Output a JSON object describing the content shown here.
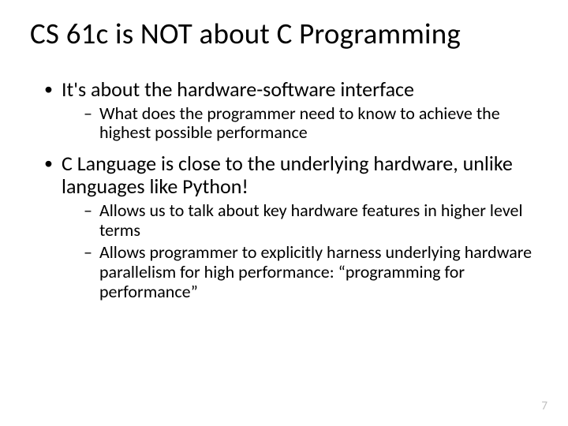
{
  "title": "CS 61c is NOT about C Programming",
  "bullets": [
    {
      "text": "It's about the hardware-software interface",
      "sub": [
        "What does the programmer need to know to achieve the highest possible performance"
      ]
    },
    {
      "text": "C Language is close to the underlying hardware, unlike languages like Python!",
      "sub": [
        "Allows us to talk about key hardware features in higher level terms",
        "Allows programmer to explicitly harness underlying hardware parallelism for high performance: “programming for performance”"
      ]
    }
  ],
  "page_number": "7"
}
